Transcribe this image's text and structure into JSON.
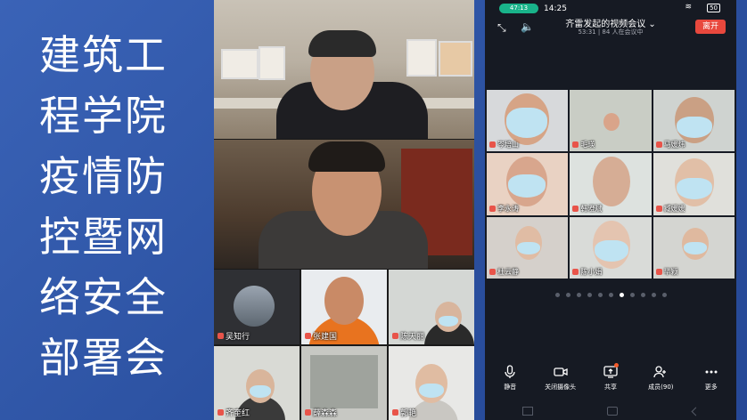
{
  "slide": {
    "title_lines": [
      "建筑工",
      "程学院",
      "疫情防",
      "控暨网",
      "络安全",
      "部署会"
    ]
  },
  "left_panel": {
    "participants": [
      "吴知行",
      "张建国",
      "陈天丽",
      "齐奎红",
      "薛森森",
      "郭艳"
    ]
  },
  "phone": {
    "status": {
      "pill": "47:13",
      "time": "14:25",
      "battery": "50"
    },
    "meeting_title": "齐雷发起的视频会议",
    "meeting_sub": "53:31 | 84 人在会议中",
    "leave_label": "离开",
    "participants": [
      "岑培山",
      "毛瑛",
      "马媛炜",
      "李永涛",
      "韩澄斌",
      "臧媛媛",
      "杜云静",
      "陈小娟",
      "毕颖"
    ],
    "page_dots": 11,
    "active_dot": 6,
    "toolbar": {
      "mute": "静音",
      "camera": "关闭摄像头",
      "share": "共享",
      "members": "成员(90)",
      "more": "更多"
    }
  }
}
